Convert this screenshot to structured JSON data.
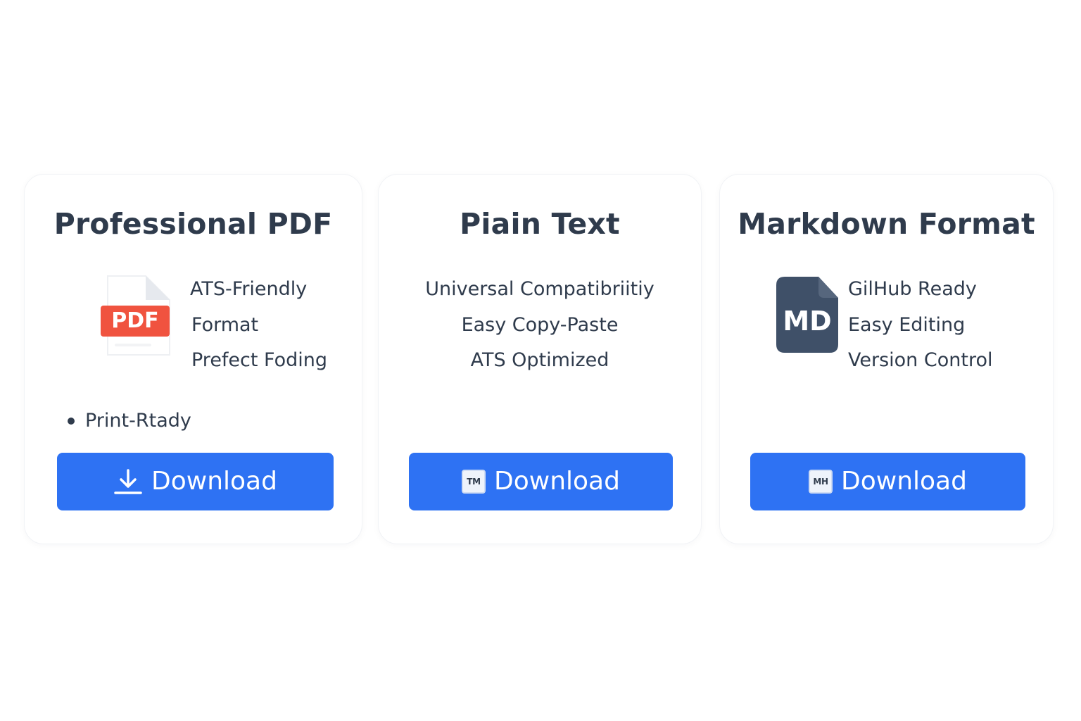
{
  "cards": [
    {
      "title": "Professional PDF",
      "icon": "pdf-file-icon",
      "icon_label": "PDF",
      "features": [
        "ATS-Friendly",
        "Format",
        "Prefect Foding"
      ],
      "bullet": "Print-Rtady",
      "button": {
        "label": "Download",
        "icon": "download-arrow-icon"
      }
    },
    {
      "title": "Piain Text",
      "features": [
        "Universal Compatibriitiy",
        "Easy Copy-Paste",
        "ATS Optimized"
      ],
      "button": {
        "label": "Download",
        "icon": "text-file-icon",
        "icon_label": "TM"
      }
    },
    {
      "title": "Markdown Format",
      "icon": "markdown-file-icon",
      "icon_label": "MD",
      "features": [
        "GilHub Ready",
        "Easy Editing",
        "Version Control"
      ],
      "button": {
        "label": "Download",
        "icon": "markdown-file-icon",
        "icon_label": "MH"
      }
    }
  ],
  "colors": {
    "button": "#2e72f3",
    "text": "#2f3b4c",
    "pdf_badge": "#f0533f",
    "md_icon": "#3f5068"
  }
}
